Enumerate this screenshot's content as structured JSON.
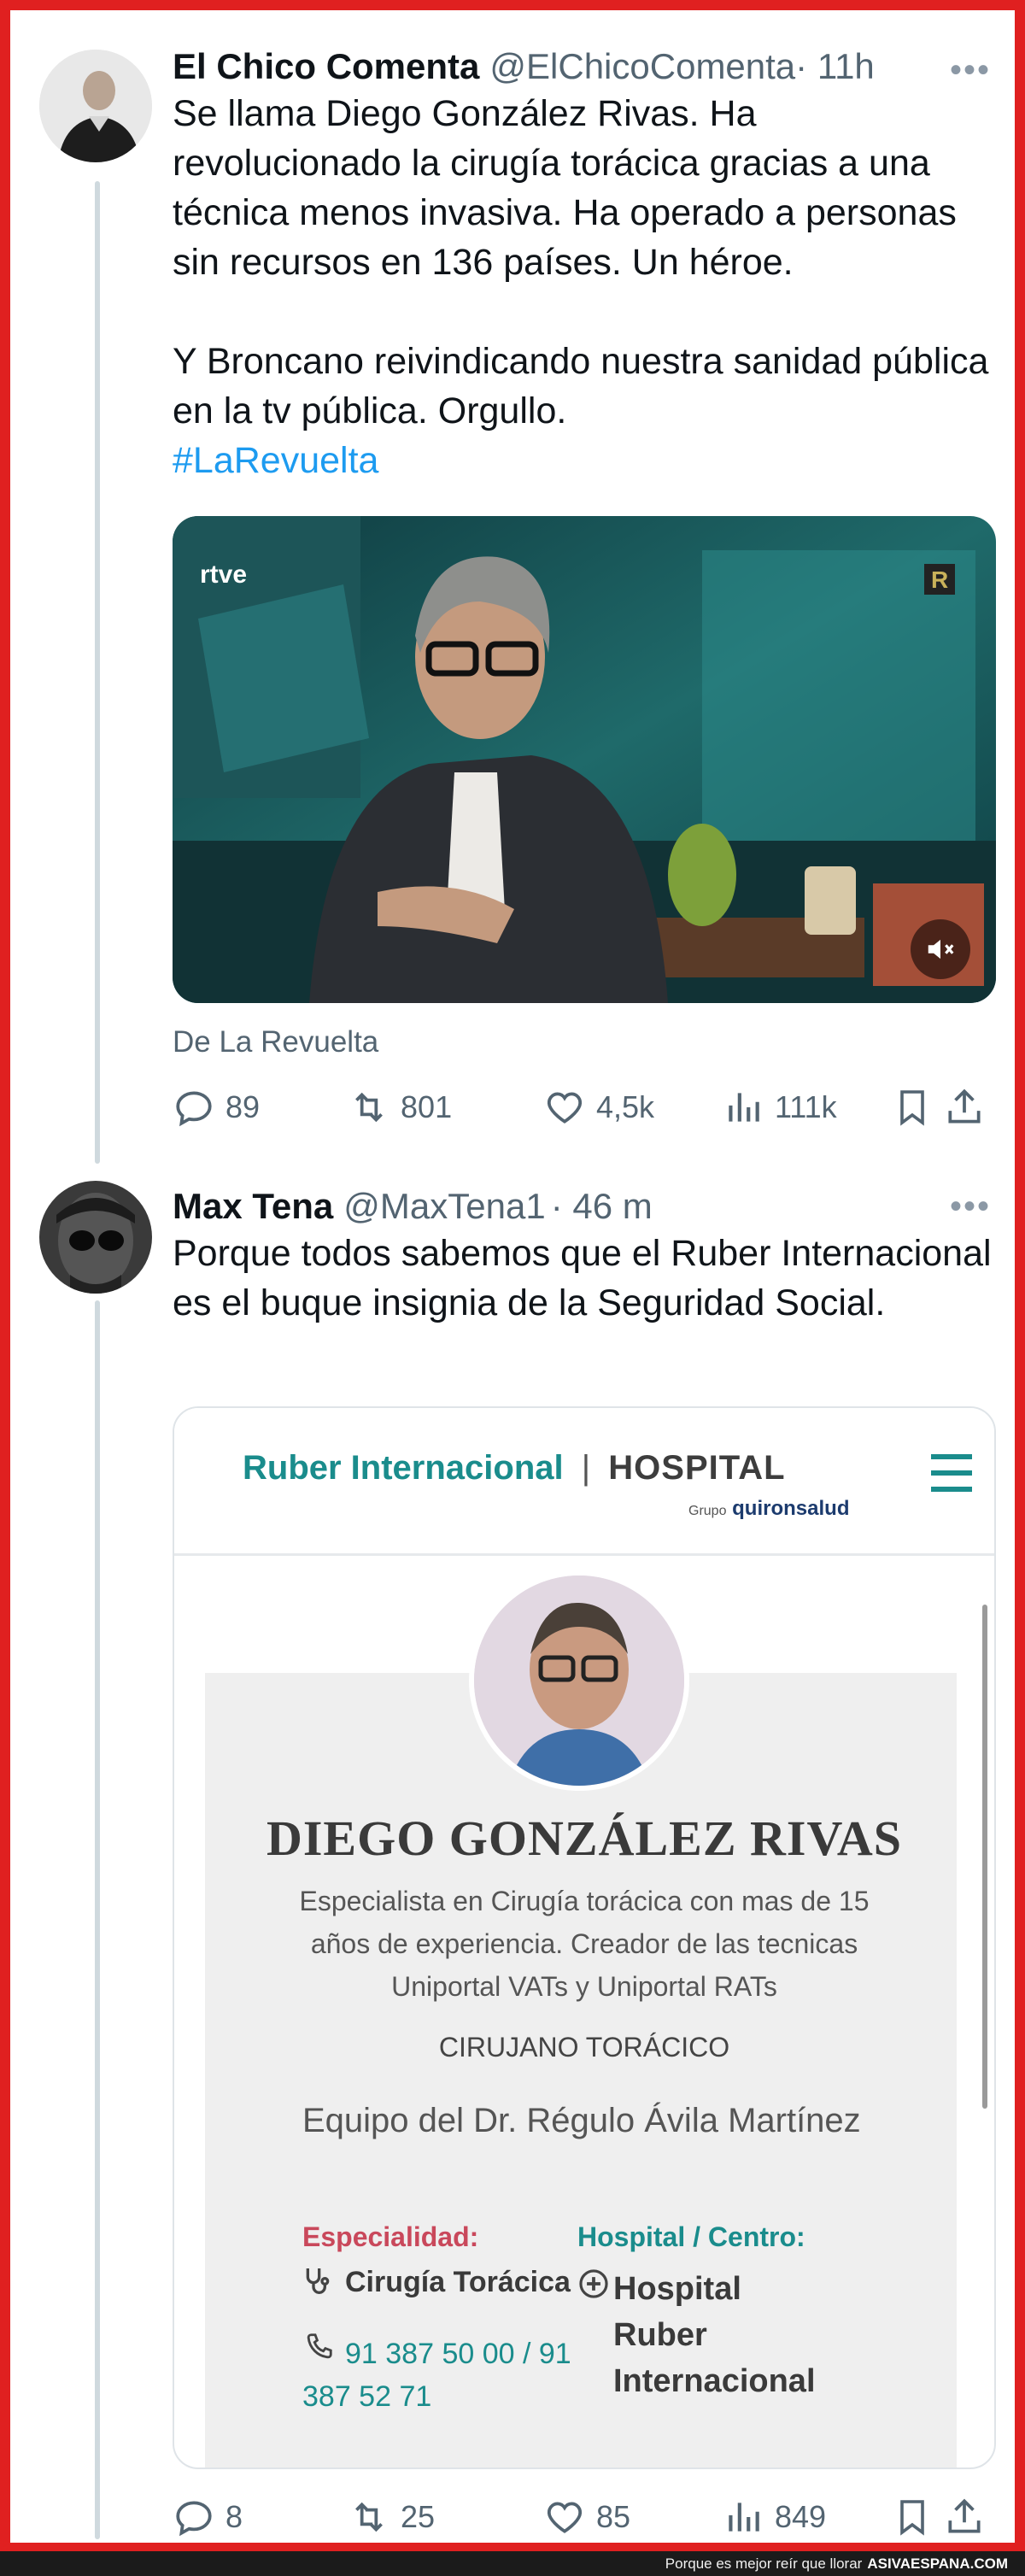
{
  "tweet1": {
    "name": "El Chico Comenta",
    "handle": "@ElChicoComenta",
    "time": "· 11h",
    "more": "•••",
    "text": "Se llama Diego González Rivas. Ha revolucionado la cirugía torácica gracias a una técnica menos invasiva. Ha operado a personas sin recursos en 136 países. Un héroe.\n\nY Broncano reivindicando nuestra sanidad pública en la tv pública. Orgullo.",
    "hashtag": "#LaRevuelta",
    "video": {
      "logo": "rtve",
      "corner_badge": "R"
    },
    "source": "De La Revuelta",
    "stats": {
      "replies": "89",
      "retweets": "801",
      "likes": "4,5k",
      "views": "111k"
    }
  },
  "tweet2": {
    "name": "Max Tena",
    "handle": "@MaxTena1",
    "time": "· 46 m",
    "more": "•••",
    "text": "Porque todos sabemos que el Ruber Internacional es el buque insignia de la Seguridad Social.",
    "screenshot": {
      "brand": "Ruber Internacional",
      "brand_separator": "|",
      "hospital_label": "HOSPITAL",
      "group_label": "Grupo",
      "group_name": "quironsalud",
      "doctor_name": "DIEGO GONZÁLEZ RIVAS",
      "description": "Especialista en Cirugía torácica con mas de 15\naños de experiencia. Creador de las tecnicas\nUniportal VATs y Uniportal RATs",
      "role": "CIRUJANO TORÁCICO",
      "team": "Equipo del Dr. Régulo Ávila Martínez",
      "specialty_label": "Especialidad:",
      "specialty_value": "Cirugía Torácica",
      "phone": "91 387 50 00 / 91\n387 52 71",
      "center_label": "Hospital / Centro:",
      "center_value": "Hospital\nRuber\nInternacional",
      "colors": {
        "teal": "#1a8c8c",
        "specialty_red": "#c9485b"
      }
    },
    "stats": {
      "replies": "8",
      "retweets": "25",
      "likes": "85",
      "views": "849"
    }
  },
  "footer": {
    "tagline": "Porque es mejor reír que llorar",
    "site": "ASIVAESPANA.COM"
  }
}
